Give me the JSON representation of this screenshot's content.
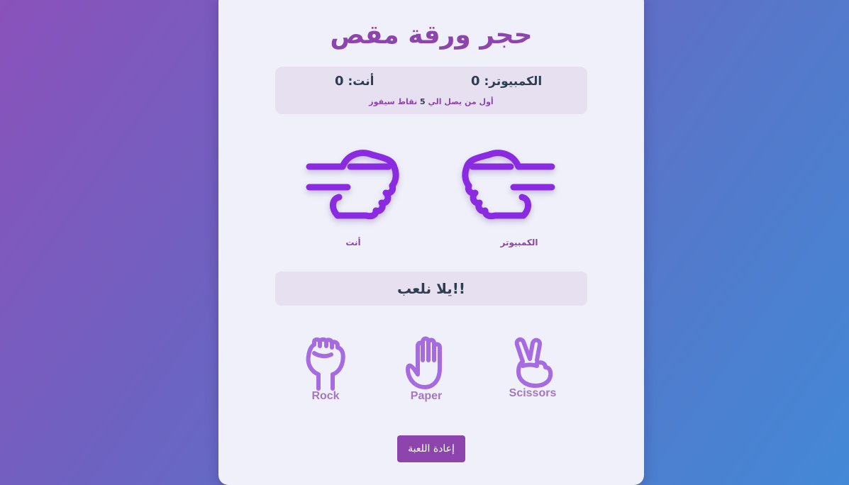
{
  "title": "حجر ورقة مقص",
  "scoreboard": {
    "user_label": "أنت:",
    "user_score": "0",
    "computer_label": "الكمبيوتر:",
    "computer_score": "0",
    "rule_before": "أول من يصل الي",
    "rule_target": "5",
    "rule_after": "نقاط سيفوز"
  },
  "arena": {
    "user_label": "أنت",
    "computer_label": "الكمبيوتر",
    "user_hand_icon": "fist-pointing-right-icon",
    "computer_hand_icon": "fist-pointing-left-icon"
  },
  "result_text": "!!يلا نلعب",
  "choices": [
    {
      "label": "Rock",
      "icon": "rock-fist-icon"
    },
    {
      "label": "Paper",
      "icon": "paper-hand-icon"
    },
    {
      "label": "Scissors",
      "icon": "scissors-hand-icon"
    }
  ],
  "restart_label": "إعادة اللعبة",
  "colors": {
    "accent": "#8e44ad",
    "hand_purple": "#8a2be2",
    "choice_purple": "#a66be0",
    "panel": "#e6e0f1",
    "card": "#eff0f9",
    "text_dark": "#2c3e50"
  }
}
